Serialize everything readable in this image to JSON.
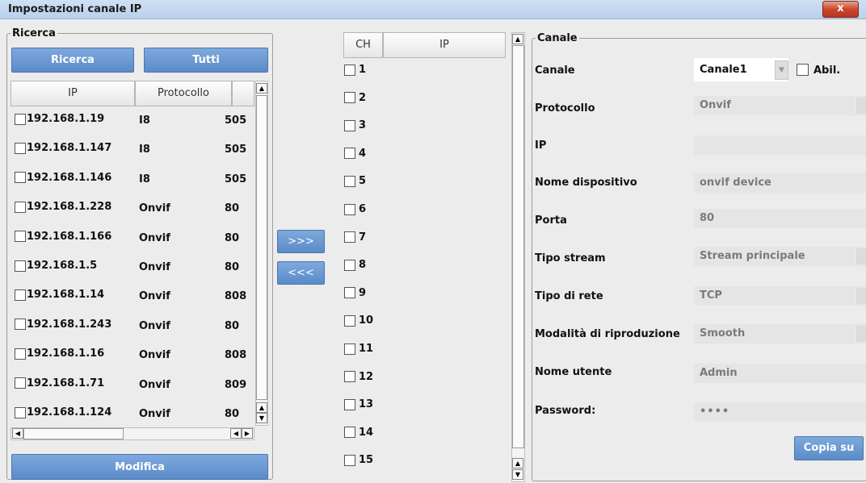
{
  "window": {
    "title": "Impostazioni canale IP",
    "close_label": "x"
  },
  "search": {
    "legend": "Ricerca",
    "search_button": "Ricerca",
    "all_button": "Tutti",
    "columns": [
      "IP",
      "Protocollo"
    ],
    "rows": [
      {
        "ip": "192.168.1.19",
        "protocol": "I8",
        "port": "505"
      },
      {
        "ip": "192.168.1.147",
        "protocol": "I8",
        "port": "505"
      },
      {
        "ip": "192.168.1.146",
        "protocol": "I8",
        "port": "505"
      },
      {
        "ip": "192.168.1.228",
        "protocol": "Onvif",
        "port": "80"
      },
      {
        "ip": "192.168.1.166",
        "protocol": "Onvif",
        "port": "80"
      },
      {
        "ip": "192.168.1.5",
        "protocol": "Onvif",
        "port": "80"
      },
      {
        "ip": "192.168.1.14",
        "protocol": "Onvif",
        "port": "808"
      },
      {
        "ip": "192.168.1.243",
        "protocol": "Onvif",
        "port": "80"
      },
      {
        "ip": "192.168.1.16",
        "protocol": "Onvif",
        "port": "808"
      },
      {
        "ip": "192.168.1.71",
        "protocol": "Onvif",
        "port": "809"
      },
      {
        "ip": "192.168.1.124",
        "protocol": "Onvif",
        "port": "80"
      }
    ],
    "modify_button": "Modifica"
  },
  "transfer": {
    "add_button": ">>>",
    "remove_button": "<<<"
  },
  "channels": {
    "columns": [
      "CH",
      "IP"
    ],
    "items": [
      "1",
      "2",
      "3",
      "4",
      "5",
      "6",
      "7",
      "8",
      "9",
      "10",
      "11",
      "12",
      "13",
      "14",
      "15"
    ]
  },
  "channel": {
    "legend": "Canale",
    "channel_label": "Canale",
    "channel_value": "Canale1",
    "enable_label": "Abil.",
    "protocol_label": "Protocollo",
    "protocol_value": "Onvif",
    "ip_label": "IP",
    "ip_value": "",
    "device_name_label": "Nome dispositivo",
    "device_name_value": "onvif device",
    "port_label": "Porta",
    "port_value": "80",
    "stream_type_label": "Tipo stream",
    "stream_type_value": "Stream principale",
    "network_type_label": "Tipo di rete",
    "network_type_value": "TCP",
    "playback_mode_label": "Modalità di riproduzione",
    "playback_mode_value": "Smooth",
    "username_label": "Nome utente",
    "username_value": "Admin",
    "password_label": "Password:",
    "password_value": "••••",
    "copy_button": "Copia su"
  }
}
